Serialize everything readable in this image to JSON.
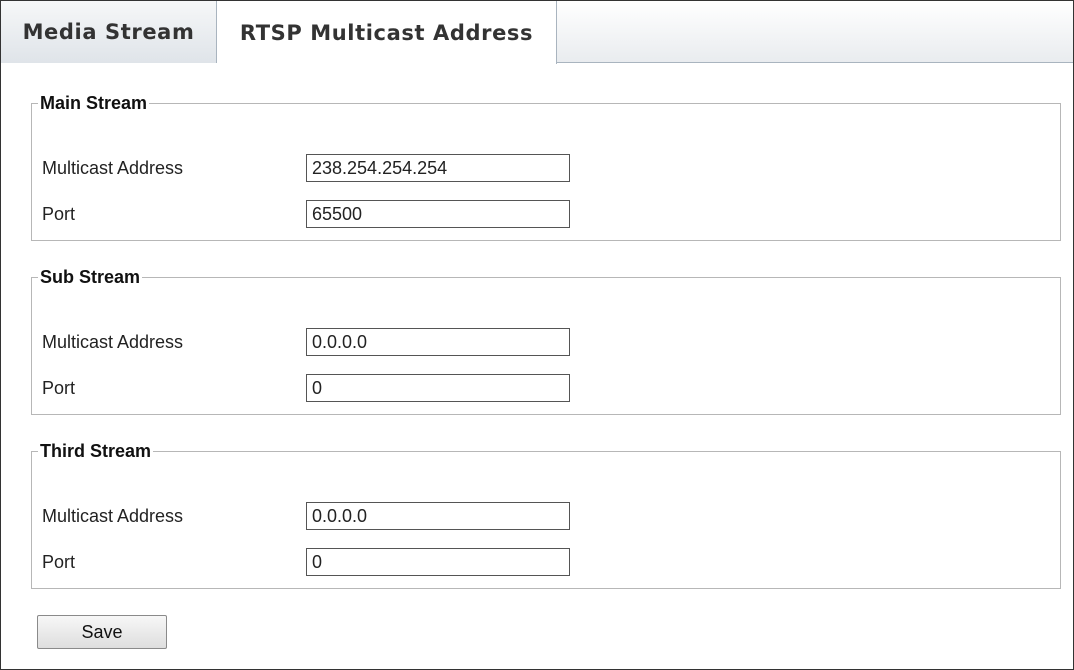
{
  "tabs": [
    {
      "label": "Media Stream",
      "active": false
    },
    {
      "label": "RTSP Multicast Address",
      "active": true
    }
  ],
  "groups": [
    {
      "title": "Main Stream",
      "multicast_label": "Multicast Address",
      "multicast_value": "238.254.254.254",
      "port_label": "Port",
      "port_value": "65500"
    },
    {
      "title": "Sub Stream",
      "multicast_label": "Multicast Address",
      "multicast_value": "0.0.0.0",
      "port_label": "Port",
      "port_value": "0"
    },
    {
      "title": "Third Stream",
      "multicast_label": "Multicast Address",
      "multicast_value": "0.0.0.0",
      "port_label": "Port",
      "port_value": "0"
    }
  ],
  "save_label": "Save",
  "colors": {
    "tabbar_gradient_top": "#ffffff",
    "tabbar_gradient_bottom": "#e9ecef",
    "group_border": "#b7b7b7",
    "input_border": "#555555"
  }
}
